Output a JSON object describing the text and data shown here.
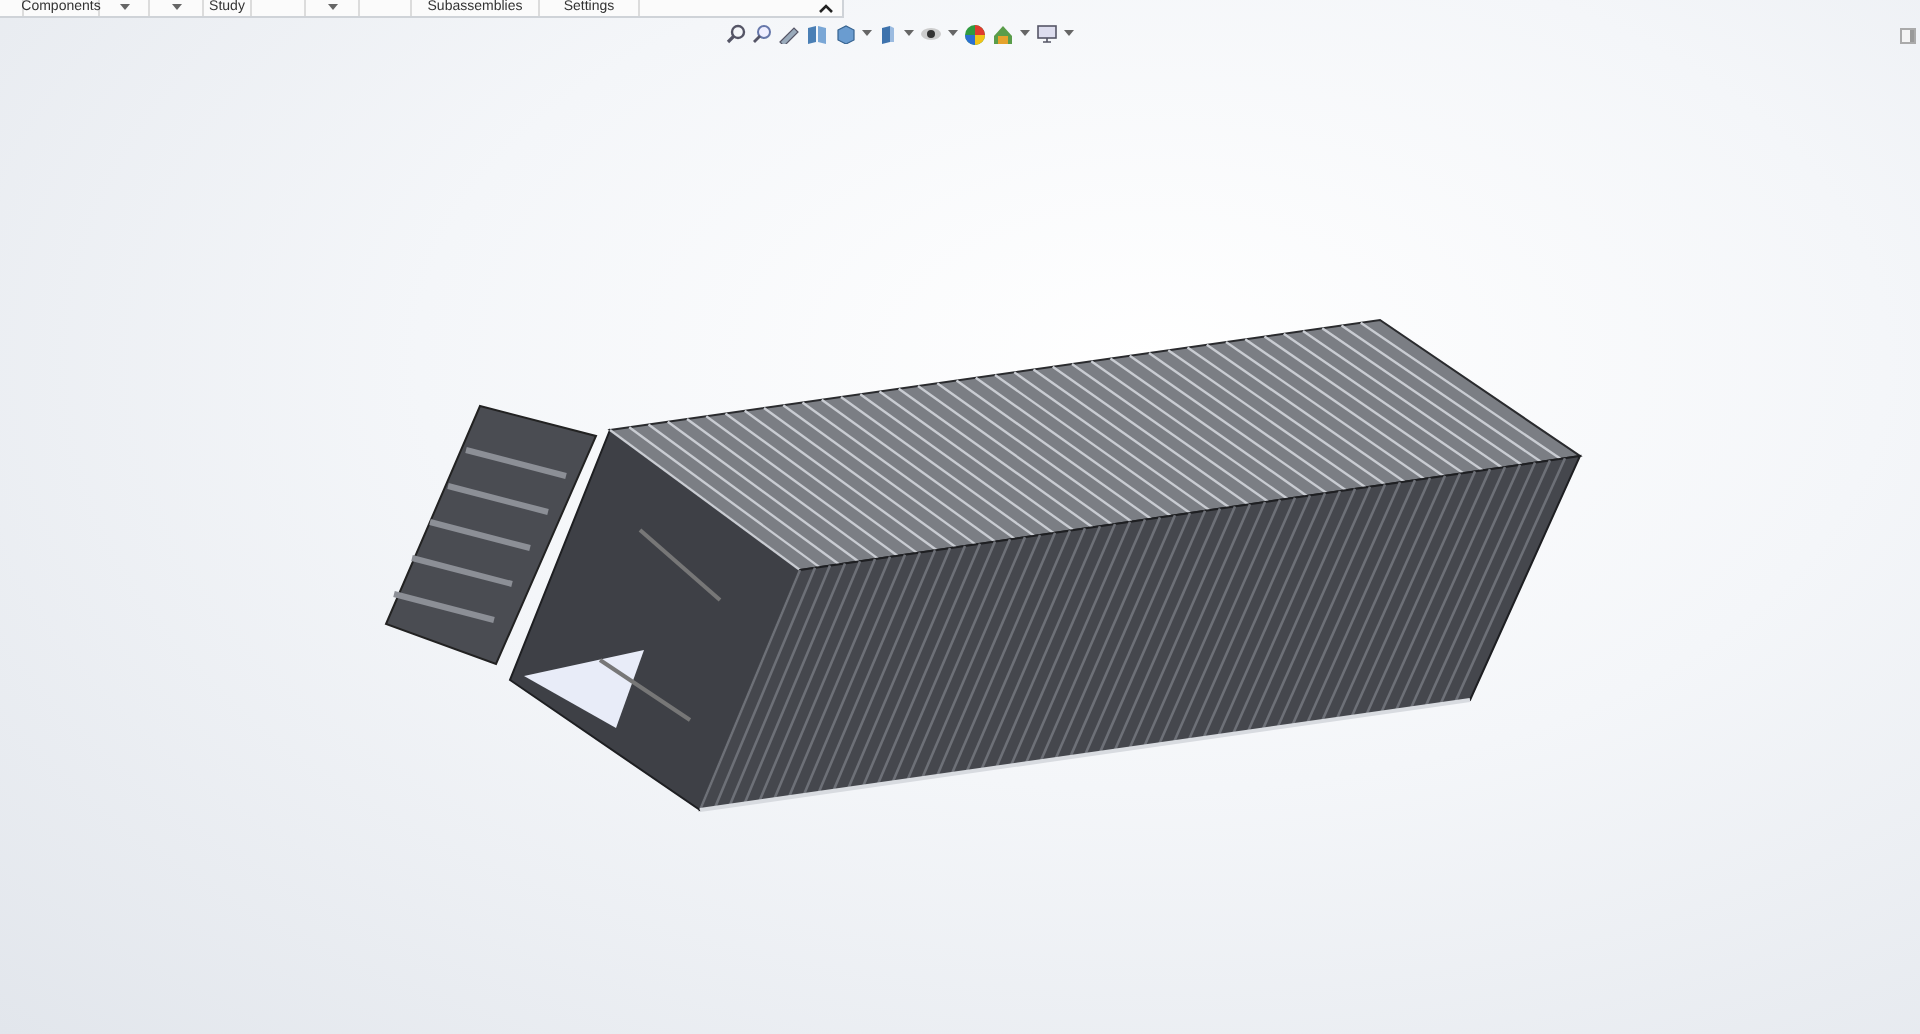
{
  "ribbon": {
    "labels": [
      {
        "text": "Components"
      },
      {
        "text": "Study"
      },
      {
        "text": "Subassemblies"
      },
      {
        "text": "Settings"
      }
    ]
  }
}
